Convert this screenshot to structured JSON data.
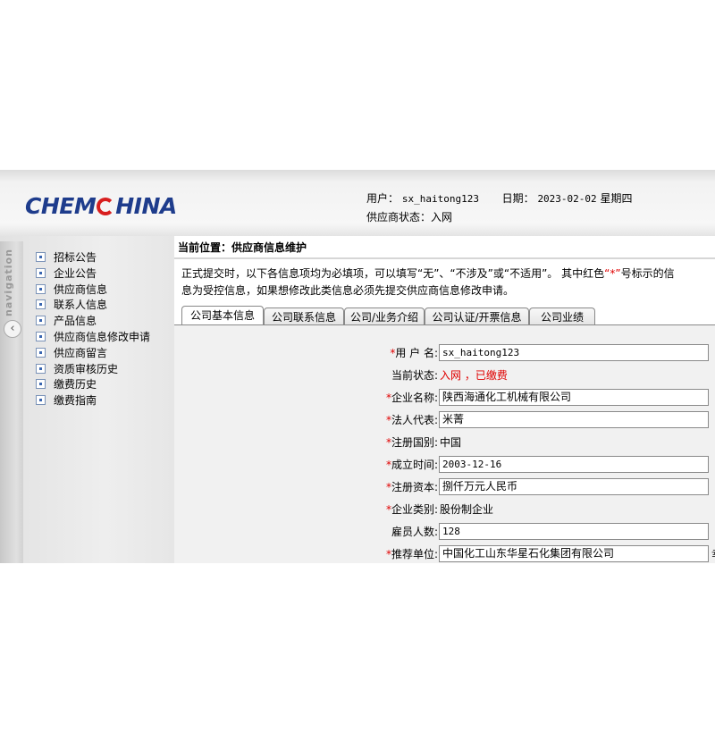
{
  "header": {
    "logo_text_left": "CHEM",
    "logo_text_right": "HINA",
    "user_label": "用户：",
    "user_value": "sx_haitong123",
    "date_label": "日期：",
    "date_value": "2023-02-02",
    "weekday": "星期四",
    "status_label": "供应商状态：",
    "status_value": "入网"
  },
  "sidebar": {
    "nav_label": "navigation",
    "collapse_glyph": "‹",
    "items": [
      {
        "label": "招标公告"
      },
      {
        "label": "企业公告"
      },
      {
        "label": "供应商信息"
      },
      {
        "label": "联系人信息"
      },
      {
        "label": "产品信息"
      },
      {
        "label": "供应商信息修改申请"
      },
      {
        "label": "供应商留言"
      },
      {
        "label": "资质审核历史"
      },
      {
        "label": "缴费历史"
      },
      {
        "label": "缴费指南"
      }
    ]
  },
  "main": {
    "breadcrumb": "当前位置：供应商信息维护",
    "notice_part1": "正式提交时，以下各信息项均为必填项，可以填写“无”、“不涉及”或“不适用”。 其中红色",
    "notice_red": "“*”",
    "notice_part2": "号标示的信息为受控信息，如果想修改此类信息必须先提交供应商信息修改申请。",
    "tabs": [
      {
        "label": "公司基本信息",
        "active": true
      },
      {
        "label": "公司联系信息",
        "active": false
      },
      {
        "label": "公司/业务介绍",
        "active": false
      },
      {
        "label": "公司认证/开票信息",
        "active": false
      },
      {
        "label": "公司业绩",
        "active": false
      }
    ],
    "form": {
      "username_label": "用 户 名:",
      "username_value": "sx_haitong123",
      "status_label": "当前状态:",
      "status_value": "入网 ，已缴费",
      "company_label": "企业名称:",
      "company_value": "陕西海通化工机械有限公司",
      "legal_label": "法人代表:",
      "legal_value": "米菁",
      "country_label": "注册国别:",
      "country_value": "中国",
      "founded_label": "成立时间:",
      "founded_value": "2003-12-16",
      "capital_label": "注册资本:",
      "capital_value": "捌仟万元人民币",
      "type_label": "企业类别:",
      "type_value": "股份制企业",
      "employees_label": "雇员人数:",
      "employees_value": "128",
      "referrer_label": "推荐单位:",
      "referrer_value": "中国化工山东华星石化集团有限公司",
      "clipped_glyph": "幸",
      "required_mark": "*"
    }
  },
  "colors": {
    "logo_blue": "#1e3c8c",
    "logo_red": "#d81e1e",
    "required_red": "#e00000"
  }
}
